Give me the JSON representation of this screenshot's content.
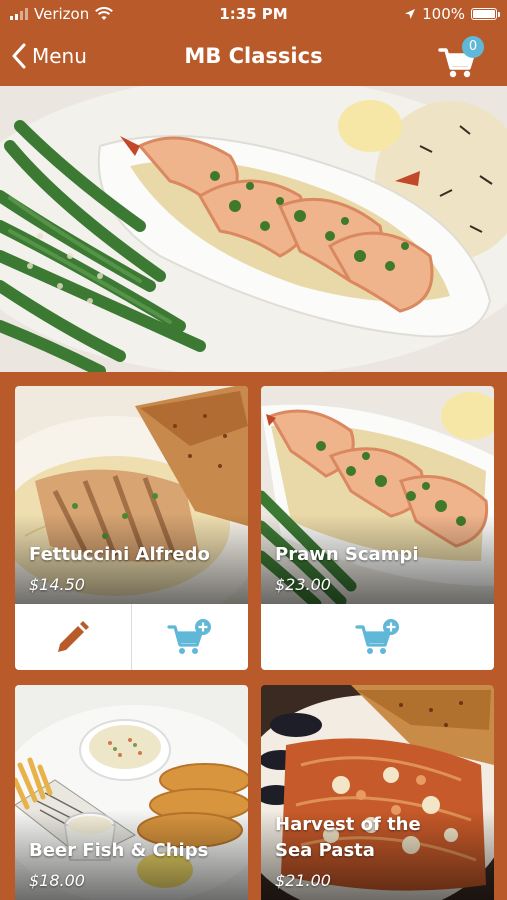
{
  "status_bar": {
    "carrier": "Verizon",
    "time": "1:35 PM",
    "battery": "100%",
    "battery_level": 1.0,
    "icons": [
      "signal-icon",
      "wifi-icon",
      "location-arrow-icon",
      "battery-icon"
    ]
  },
  "nav": {
    "back_label": "Menu",
    "title": "MB Classics",
    "cart_count": "0"
  },
  "items": [
    {
      "name": "Fettuccini Alfredo",
      "price": "$14.50",
      "actions": [
        "pencil-icon",
        "add-to-cart-icon"
      ]
    },
    {
      "name": "Prawn Scampi",
      "price": "$23.00",
      "actions": [
        "add-to-cart-icon"
      ]
    },
    {
      "name": "Beer Fish & Chips",
      "price": "$18.00"
    },
    {
      "name": "Harvest of the Sea Pasta",
      "name_line1": "Harvest of the",
      "name_line2": "Sea Pasta",
      "price": "$21.00"
    }
  ],
  "colors": {
    "brand": "#b85a2a",
    "accent": "#5fb8d8",
    "edit_icon": "#b85a2a",
    "card_bg": "#ffffff"
  }
}
